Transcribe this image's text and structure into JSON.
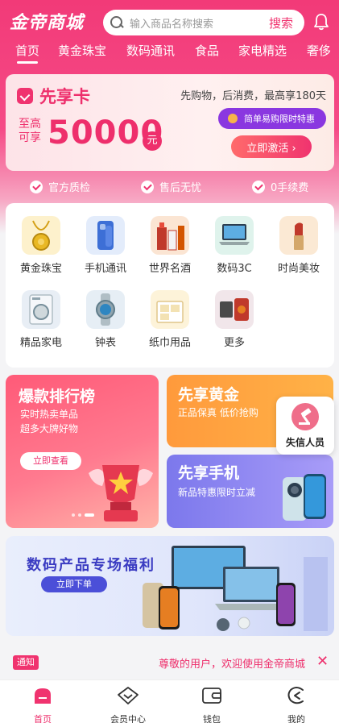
{
  "app": {
    "logo": "金帝商城"
  },
  "search": {
    "placeholder": "输入商品名称搜索",
    "button": "搜索"
  },
  "nav": {
    "items": [
      {
        "label": "首页",
        "active": true
      },
      {
        "label": "黄金珠宝"
      },
      {
        "label": "数码通讯"
      },
      {
        "label": "食品"
      },
      {
        "label": "家电精选"
      },
      {
        "label": "奢侈"
      }
    ]
  },
  "vip_card": {
    "title": "先享卡",
    "desc": "先购物，后消费，最高享180天",
    "upto_label": "至高可享",
    "amount": "50000",
    "unit": "元",
    "promo": "简单易购限时特惠",
    "activate": "立即激活 ›"
  },
  "guarantees": [
    "官方质检",
    "售后无忧",
    "0手续费"
  ],
  "categories": [
    {
      "label": "黄金珠宝",
      "icon": "gold-necklace-icon"
    },
    {
      "label": "手机通讯",
      "icon": "smartphone-icon"
    },
    {
      "label": "世界名酒",
      "icon": "liquor-icon"
    },
    {
      "label": "数码3C",
      "icon": "laptop-icon"
    },
    {
      "label": "时尚美妆",
      "icon": "lipstick-icon"
    },
    {
      "label": "精品家电",
      "icon": "washing-machine-icon"
    },
    {
      "label": "钟表",
      "icon": "watch-icon"
    },
    {
      "label": "纸巾用品",
      "icon": "tissue-icon"
    },
    {
      "label": "更多",
      "icon": "more-icon"
    }
  ],
  "promos": {
    "ranking": {
      "title": "爆款排行榜",
      "sub1": "实时热卖单品",
      "sub2": "超多大牌好物",
      "button": "立即查看"
    },
    "gold": {
      "title": "先享黄金",
      "sub": "正品保真 低价抢购"
    },
    "phone": {
      "title": "先享手机",
      "sub": "新品特惠限时立减"
    },
    "dishonest": {
      "label": "失信人员"
    }
  },
  "banner": {
    "title": "数码产品专场福利",
    "button": "立即下单"
  },
  "notice": {
    "tag": "通知",
    "text": "尊敬的用户，欢迎使用金帝商城",
    "close": "✕"
  },
  "tabbar": [
    {
      "label": "首页",
      "icon": "home-icon",
      "active": true
    },
    {
      "label": "会员中心",
      "icon": "diamond-icon"
    },
    {
      "label": "钱包",
      "icon": "wallet-icon"
    },
    {
      "label": "我的",
      "icon": "profile-icon"
    }
  ],
  "colors": {
    "brand": "#f0336f",
    "accent_purple": "#8a37e0"
  }
}
